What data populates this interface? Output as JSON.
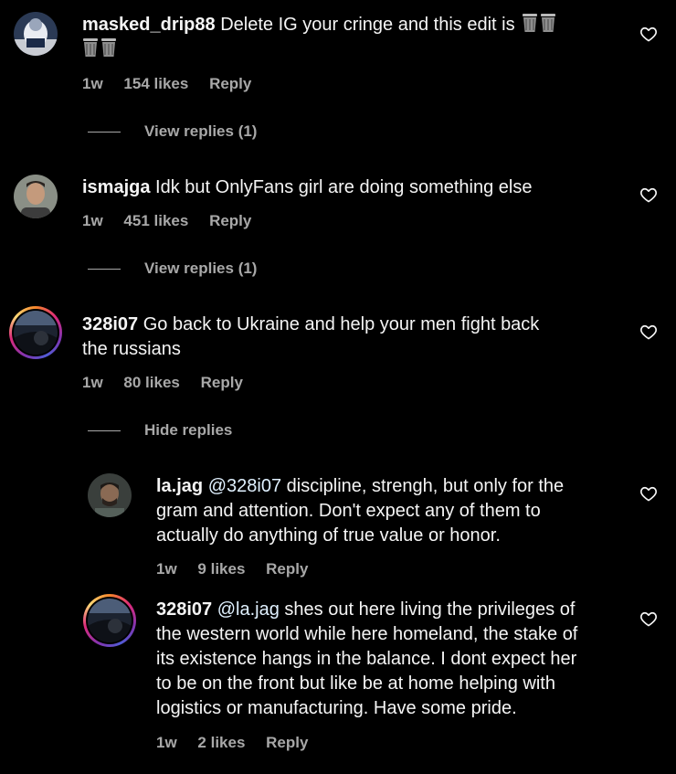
{
  "comments": [
    {
      "username": "masked_drip88",
      "text": "Delete IG your cringe and this edit is",
      "emoji": "wastebasket-emoji",
      "time": "1w",
      "likes": "154 likes",
      "reply": "Reply",
      "thread": "View replies (1)"
    },
    {
      "username": "ismajga",
      "text": "Idk but OnlyFans girl are doing something else",
      "time": "1w",
      "likes": "451 likes",
      "reply": "Reply",
      "thread": "View replies (1)"
    },
    {
      "username": "328i07",
      "text_line1": "Go back to Ukraine and help your men fight back",
      "text_line2": "the russians",
      "time": "1w",
      "likes": "80 likes",
      "reply": "Reply",
      "thread": "Hide replies"
    }
  ],
  "replies": [
    {
      "username": "la.jag",
      "mention": "@328i07",
      "line1": "discipline, strengh, but only for the",
      "line2": "gram and attention. Don't expect any of them to",
      "line3": "actually do anything of true value or honor.",
      "time": "1w",
      "likes": "9 likes",
      "reply": "Reply"
    },
    {
      "username": "328i07",
      "mention": "@la.jag",
      "line1": "shes out here living the privileges of",
      "line2": "the western world while here homeland, the stake of",
      "line3": "its existence hangs in the balance. I dont expect her",
      "line4": "to be on the front but like be at home helping with",
      "line5": "logistics or manufacturing. Have some pride.",
      "time": "1w",
      "likes": "2 likes",
      "reply": "Reply"
    }
  ],
  "icons": {
    "like": "heart-outline-icon"
  },
  "colors": {
    "background": "#000000",
    "text": "#f5f5f5",
    "secondary": "#a8a8a8",
    "mention": "#e0f1ff"
  }
}
